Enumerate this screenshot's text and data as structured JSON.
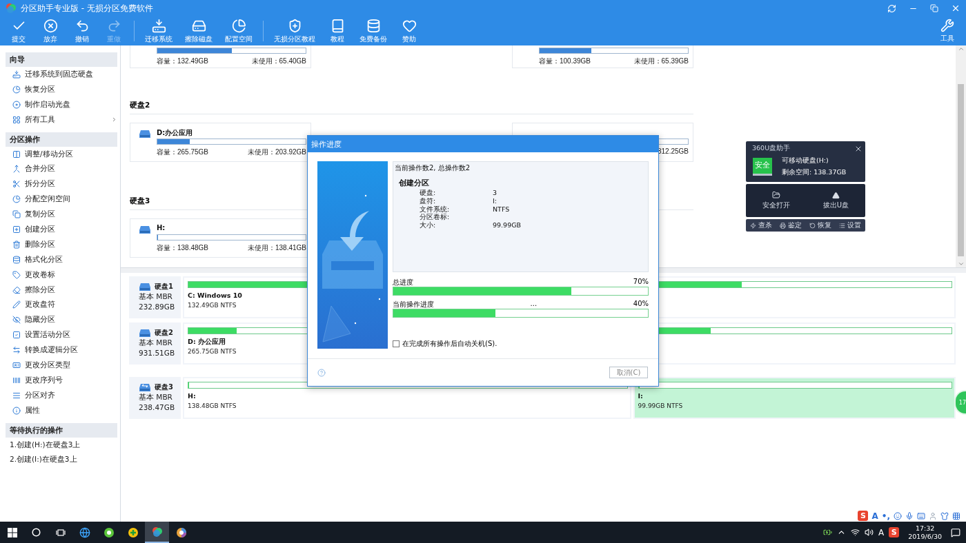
{
  "window": {
    "title": "分区助手专业版 - 无损分区免费软件"
  },
  "toolbar": [
    {
      "label": "提交",
      "disabled": false,
      "divider_before": false
    },
    {
      "label": "放弃",
      "disabled": false,
      "divider_before": false
    },
    {
      "label": "撤销",
      "disabled": false,
      "divider_before": false
    },
    {
      "label": "重做",
      "disabled": true,
      "divider_before": false
    },
    {
      "label": "迁移系统",
      "disabled": false,
      "divider_before": true
    },
    {
      "label": "擦除磁盘",
      "disabled": false,
      "divider_before": false
    },
    {
      "label": "配置空间",
      "disabled": false,
      "divider_before": false
    },
    {
      "label": "无损分区教程",
      "disabled": false,
      "divider_before": true
    },
    {
      "label": "教程",
      "disabled": false,
      "divider_before": false
    },
    {
      "label": "免费备份",
      "disabled": false,
      "divider_before": false
    },
    {
      "label": "赞助",
      "disabled": false,
      "divider_before": false
    }
  ],
  "tools_button": {
    "label": "工具"
  },
  "sidebar": {
    "sections": [
      {
        "title": "向导",
        "items": [
          {
            "label": "迁移系统到固态硬盘",
            "submenu": false
          },
          {
            "label": "恢复分区",
            "submenu": false
          },
          {
            "label": "制作启动光盘",
            "submenu": false
          },
          {
            "label": "所有工具",
            "submenu": true
          }
        ]
      },
      {
        "title": "分区操作",
        "items": [
          {
            "label": "调整/移动分区"
          },
          {
            "label": "合并分区"
          },
          {
            "label": "拆分分区"
          },
          {
            "label": "分配空闲空间"
          },
          {
            "label": "复制分区"
          },
          {
            "label": "创建分区"
          },
          {
            "label": "删除分区"
          },
          {
            "label": "格式化分区"
          },
          {
            "label": "更改卷标"
          },
          {
            "label": "擦除分区"
          },
          {
            "label": "更改盘符"
          },
          {
            "label": "隐藏分区"
          },
          {
            "label": "设置活动分区"
          },
          {
            "label": "转换成逻辑分区"
          },
          {
            "label": "更改分区类型"
          },
          {
            "label": "更改序列号"
          },
          {
            "label": "分区对齐"
          },
          {
            "label": "属性"
          }
        ]
      },
      {
        "title": "等待执行的操作",
        "items": [
          {
            "label": "1.创建(H:)在硬盘3上"
          },
          {
            "label": "2.创建(I:)在硬盘3上"
          }
        ]
      }
    ]
  },
  "partition_cards": {
    "groups": [
      {
        "items": [
          {
            "level": 0.5,
            "capacity": "容量：132.49GB",
            "unused": "未使用：65.40GB"
          },
          {
            "level": 0.35,
            "capacity": "容量：100.39GB",
            "unused": "未使用：65.39GB"
          }
        ]
      },
      {
        "heading": "硬盘2",
        "items": [
          {
            "label": "D:办公应用",
            "level": 0.22,
            "capacity": "容量：265.75GB",
            "unused": "未使用：203.92GB"
          },
          {
            "unused": "312.25GB"
          }
        ]
      },
      {
        "heading": "硬盘3",
        "items": [
          {
            "label": "H:",
            "level": 0,
            "capacity": "容量：138.48GB",
            "unused": "未使用：138.41GB"
          }
        ]
      }
    ]
  },
  "disk_map": [
    {
      "name": "硬盘1",
      "kind": "fixed",
      "type": "基本 MBR",
      "size": "232.89GB",
      "partitions": [
        {
          "label": "C: Windows 10",
          "info": "132.49GB NTFS",
          "level": 0.5,
          "selected": false
        },
        {
          "level": 0.33,
          "selected": false
        }
      ]
    },
    {
      "name": "硬盘2",
      "kind": "fixed",
      "type": "基本 MBR",
      "size": "931.51GB",
      "partitions": [
        {
          "label": "D: 办公应用",
          "info": "265.75GB NTFS",
          "level": 0.11,
          "selected": false
        },
        {
          "level": 0.23,
          "selected": false
        }
      ]
    },
    {
      "name": "硬盘3",
      "kind": "removable",
      "type": "基本 MBR",
      "size": "238.47GB",
      "partitions": [
        {
          "label": "H:",
          "info": "138.48GB NTFS",
          "level": 0,
          "selected": false
        },
        {
          "label": "I:",
          "info": "99.99GB NTFS",
          "level": 0,
          "selected": true
        }
      ]
    }
  ],
  "dialog": {
    "title": "操作进度",
    "summary": "当前操作数2, 总操作数2",
    "operation": "创建分区",
    "details": [
      {
        "key": "硬盘:",
        "value": "3"
      },
      {
        "key": "盘符:",
        "value": "I:"
      },
      {
        "key": "文件系统:",
        "value": "NTFS"
      },
      {
        "key": "分区卷标:"
      },
      {
        "key": "大小:",
        "value": "99.99GB"
      }
    ],
    "progress": [
      {
        "label": "总进度",
        "percent": "70%",
        "level": 0.7
      },
      {
        "label": "当前操作进度",
        "status": "...",
        "percent": "40%",
        "level": 0.4
      }
    ],
    "shutdown": {
      "label": "在完成所有操作后自动关机(S).",
      "checked": false
    },
    "cancel": "取消(C)"
  },
  "usb_helper": {
    "title": "360U盘助手",
    "badge": "安全",
    "drive": "可移动硬盘(H:)",
    "free": "剩余空间: 138.37GB",
    "actions": [
      "安全打开",
      "拔出U盘"
    ],
    "tools": [
      "查杀",
      "鉴定",
      "恢复",
      "设置"
    ]
  },
  "float_ball": {
    "text": "17"
  },
  "ime_bar": {
    "logo": "S",
    "mode": "A",
    "punct": "•,"
  },
  "taskbar": {
    "apps": [
      {
        "active": false
      },
      {
        "active": false
      },
      {
        "active": false
      },
      {
        "active": true
      },
      {
        "active": false
      }
    ],
    "ime": "A",
    "logo": "S",
    "time": "17:32",
    "date": "2019/6/30"
  }
}
